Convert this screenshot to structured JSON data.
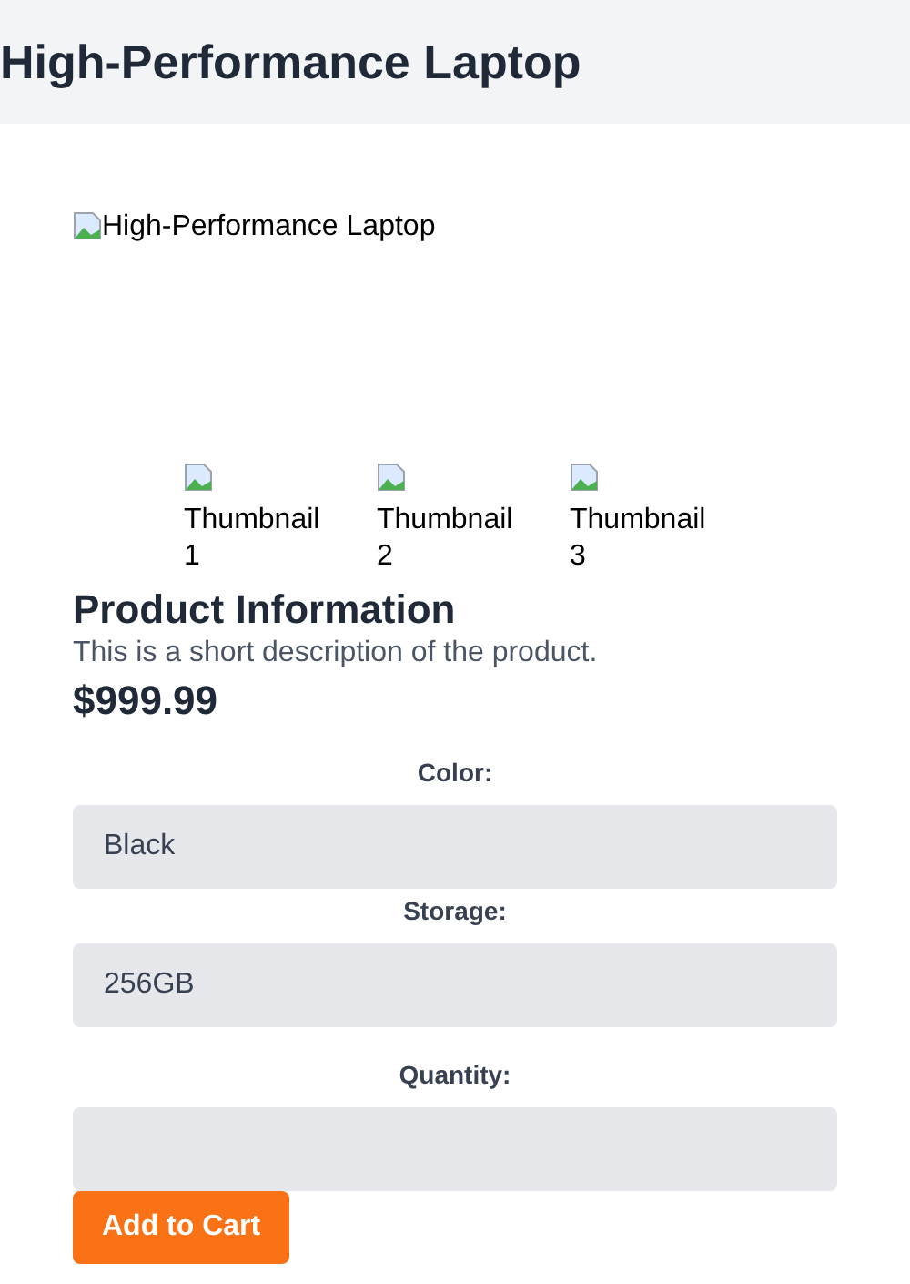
{
  "header": {
    "title": "High-Performance Laptop"
  },
  "main_image": {
    "alt": "High-Performance Laptop"
  },
  "thumbnails": [
    {
      "alt": "Thumbnail 1"
    },
    {
      "alt": "Thumbnail 2"
    },
    {
      "alt": "Thumbnail 3"
    }
  ],
  "product": {
    "heading": "Product Information",
    "description": "This is a short description of the product.",
    "price": "$999.99"
  },
  "form": {
    "fields": [
      {
        "kind": "select",
        "label": "Color:",
        "value": "Black"
      },
      {
        "kind": "select",
        "label": "Storage:",
        "value": "256GB"
      },
      {
        "kind": "input",
        "label": "Quantity:"
      }
    ],
    "button": "Add to Cart"
  }
}
